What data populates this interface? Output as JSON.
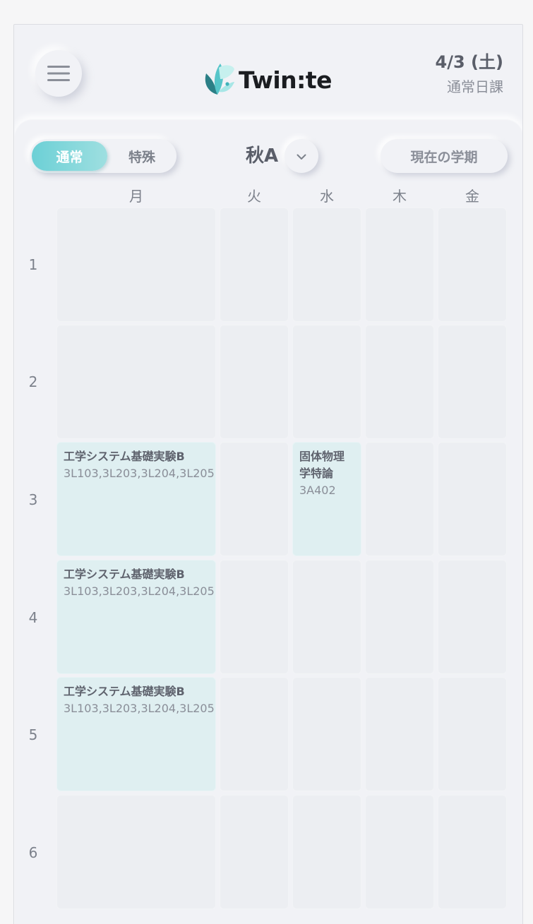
{
  "header": {
    "logo_text": "Twin:te",
    "date": "4/3 (土)",
    "schedule_type": "通常日課"
  },
  "controls": {
    "toggle_normal": "通常",
    "toggle_special": "特殊",
    "term": "秋A",
    "current_term_button": "現在の学期"
  },
  "days": [
    "月",
    "火",
    "水",
    "木",
    "金"
  ],
  "periods": [
    "1",
    "2",
    "3",
    "4",
    "5",
    "6"
  ],
  "courses": {
    "mon3": {
      "name": "工学システム基礎実験B",
      "room": "3L103,3L203,3L204,3L205"
    },
    "mon4": {
      "name": "工学システム基礎実験B",
      "room": "3L103,3L203,3L204,3L205"
    },
    "mon5": {
      "name": "工学システム基礎実験B",
      "room": "3L103,3L203,3L204,3L205"
    },
    "wed3": {
      "name": "固体物理学特論",
      "room": "3A402"
    }
  },
  "colors": {
    "accent": "#6cd0d6",
    "course_bg": "#dfeff1",
    "background": "#f1f2f6"
  },
  "icons": {
    "menu": "hamburger-icon",
    "term_dropdown": "chevron-down-icon",
    "logo": "butterfly-logo-icon"
  }
}
